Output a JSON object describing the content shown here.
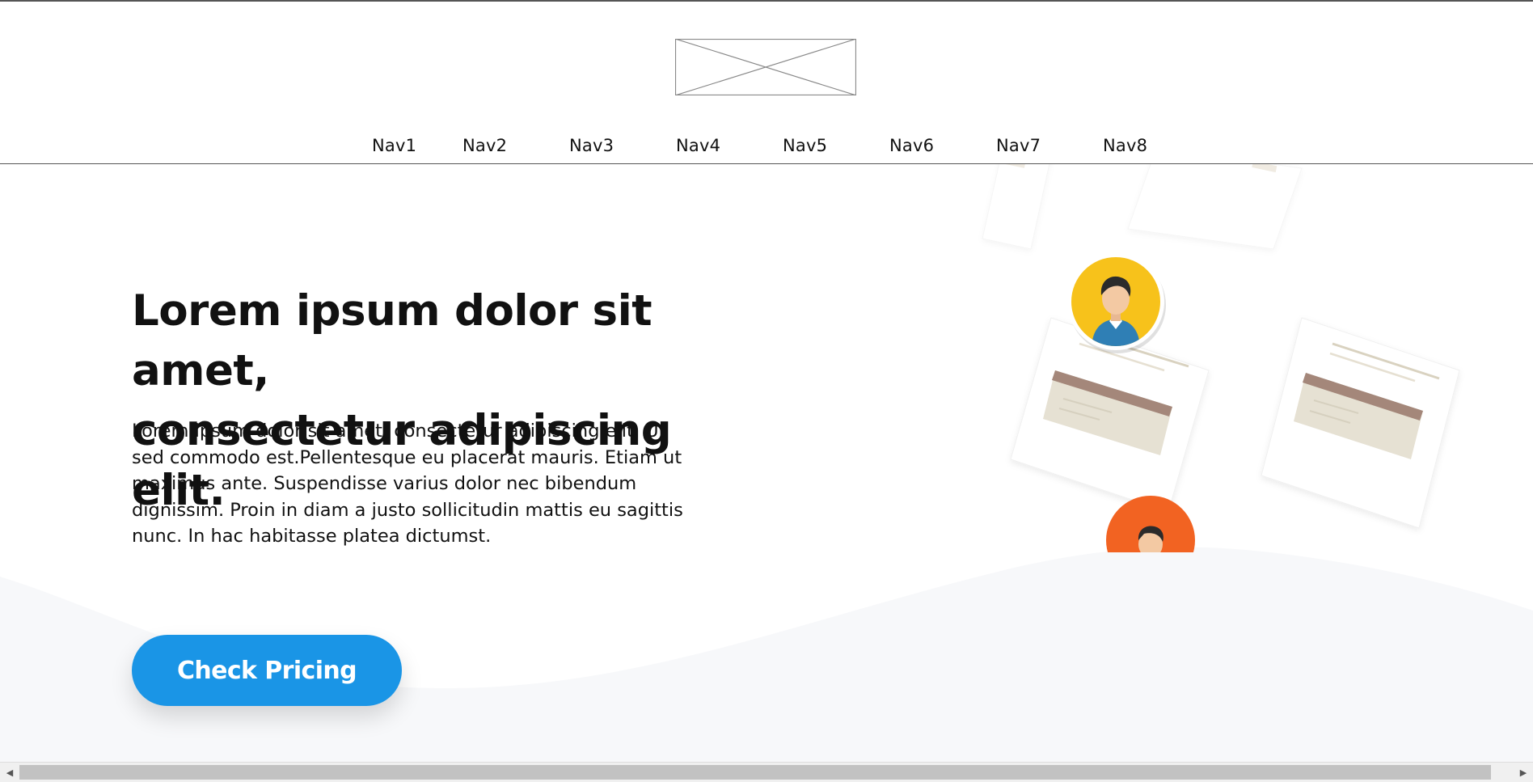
{
  "header": {
    "logo": {
      "icon": "image-placeholder-icon"
    },
    "nav": [
      "Nav1",
      "Nav2",
      "Nav3",
      "Nav4",
      "Nav5",
      "Nav6",
      "Nav7",
      "Nav8"
    ]
  },
  "hero": {
    "headline_line1": "Lorem ipsum dolor sit amet,",
    "headline_line2": "consectetur adipiscing elit.",
    "body": "Lorem ipsum dolor sit amet, consectetur adipiscing elit. Ut sed commodo est.Pellentesque eu placerat mauris. Etiam ut maximus ante. Suspendisse varius dolor nec bibendum dignissim. Proin in diam a justo sollicitudin mattis eu sagittis nunc. In hac habitasse platea dictumst.",
    "cta_label": "Check Pricing"
  },
  "colors": {
    "accent": "#1a95e6",
    "wave": "#f7f8fa",
    "avatar_yellow": "#f7c21b",
    "avatar_orange": "#f26322"
  },
  "scrollbar": {
    "left_icon": "arrow-left-icon",
    "right_icon": "arrow-right-icon"
  }
}
